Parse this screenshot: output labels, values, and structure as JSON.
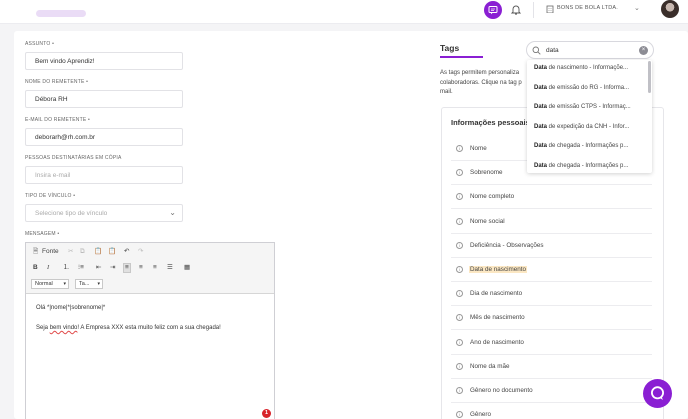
{
  "header": {
    "company": "BONS DE BOLA LTDA.",
    "icons": [
      "chat-icon",
      "bell-icon",
      "building-icon",
      "chevron-down-icon",
      "avatar"
    ]
  },
  "form": {
    "subject": {
      "label": "ASSUNTO",
      "value": "Bem vindo Aprendiz!"
    },
    "sender_name": {
      "label": "NOME DO REMETENTE",
      "value": "Débora RH"
    },
    "sender_email": {
      "label": "E-MAIL DO REMETENTE",
      "value": "deborarh@rh.com.br"
    },
    "cc": {
      "label": "PESSOAS DESTINATÁRIAS EM CÓPIA",
      "placeholder": "Insira e-mail"
    },
    "link_type": {
      "label": "TIPO DE VÍNCULO",
      "placeholder": "Selecione tipo de vínculo"
    },
    "message": {
      "label": "MENSAGEM"
    }
  },
  "editor": {
    "source_label": "Fonte",
    "format_value": "Normal",
    "size_value": "Ta...",
    "line1": "Olá *|nome|*|sobrenome|*",
    "line2_pre": "Seja ",
    "line2_err": "bem vindo",
    "line2_post": "! A Empresa XXX esta muito feliz com a sua chegada!",
    "badge_count": "1"
  },
  "tags": {
    "title": "Tags",
    "description": "As tags permitem personaliza colaboradoras. Clique na tag p mail."
  },
  "info": {
    "title": "Informações pessoais",
    "items": [
      "Nome",
      "Sobrenome",
      "Nome completo",
      "Nome social",
      "Deficiência - Observações",
      "Data de nascimento",
      "Dia de nascimento",
      "Mês de nascimento",
      "Ano de nascimento",
      "Nome da mãe",
      "Gênero no documento",
      "Gênero"
    ],
    "highlighted_index": 5
  },
  "search": {
    "value": "data",
    "results": [
      {
        "match": "Data",
        "rest": " de nascimento - Informaçõe..."
      },
      {
        "match": "Data",
        "rest": " de emissão do RG - Informa..."
      },
      {
        "match": "Data",
        "rest": " de emissão CTPS - Informaç..."
      },
      {
        "match": "Data",
        "rest": " de expedição da CNH - Infor..."
      },
      {
        "match": "Data",
        "rest": " de chegada - Informações p..."
      },
      {
        "match": "Data",
        "rest": " de chegada - Informações p..."
      }
    ]
  },
  "colors": {
    "accent": "#8a1fd3",
    "highlight": "#fbe7c3",
    "badge": "#d8232a"
  }
}
